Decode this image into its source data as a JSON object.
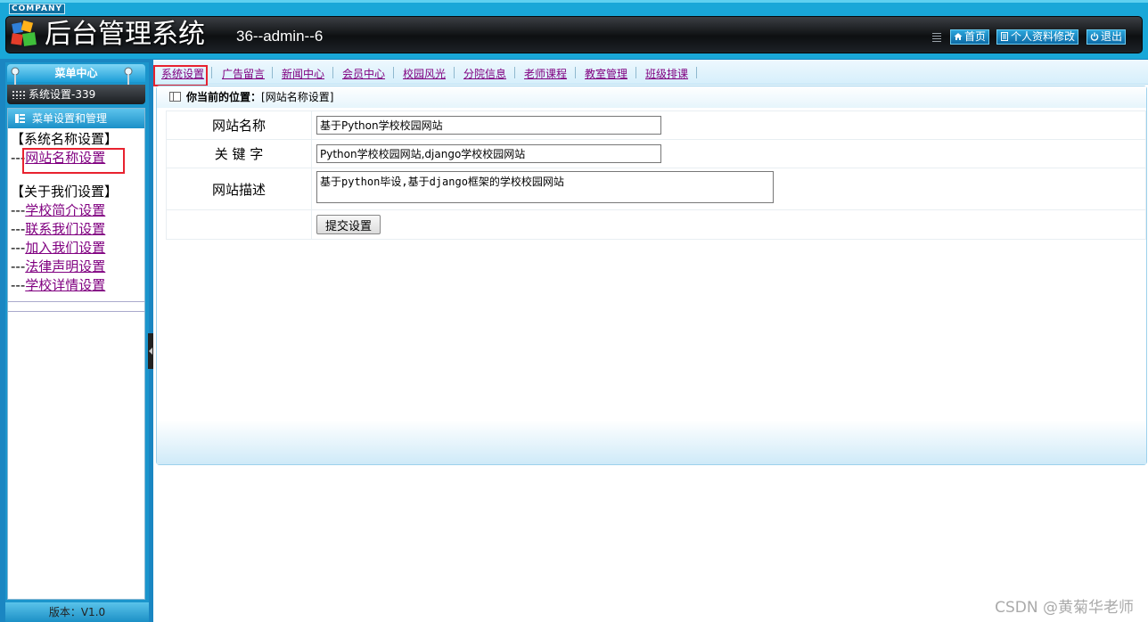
{
  "header": {
    "company": "COMPANY",
    "title": "后台管理系统",
    "user": "36--admin--6",
    "home_label": "首页",
    "profile_label": "个人资料修改",
    "logout_label": "退出"
  },
  "sidebar": {
    "menu_title": "菜单中心",
    "system_label": "系统设置-339",
    "section_title": "菜单设置和管理",
    "groups": [
      {
        "title": "【系统名称设置】",
        "items": [
          "网站名称设置"
        ]
      },
      {
        "title": "【关于我们设置】",
        "items": [
          "学校简介设置",
          "联系我们设置",
          "加入我们设置",
          "法律声明设置",
          "学校详情设置"
        ]
      }
    ],
    "item_prefix": "---",
    "version": "版本：V1.0"
  },
  "tabs": [
    "系统设置",
    "广告留言",
    "新闻中心",
    "会员中心",
    "校园风光",
    "分院信息",
    "老师课程",
    "教室管理",
    "班级排课"
  ],
  "location": {
    "label": "你当前的位置：",
    "value": "[网站名称设置]"
  },
  "form": {
    "site_name_label": "网站名称",
    "site_name_value": "基于Python学校校园网站",
    "keywords_label": "关 键 字",
    "keywords_value": "Python学校校园网站,django学校校园网站",
    "description_label": "网站描述",
    "description_value": "基于python毕设,基于django框架的学校校园网站",
    "submit_label": "提交设置"
  },
  "watermark": "CSDN @黄菊华老师",
  "colors": {
    "highlight": "#e8222f",
    "link_visited": "#800080",
    "theme_blue": "#1a86c2"
  }
}
